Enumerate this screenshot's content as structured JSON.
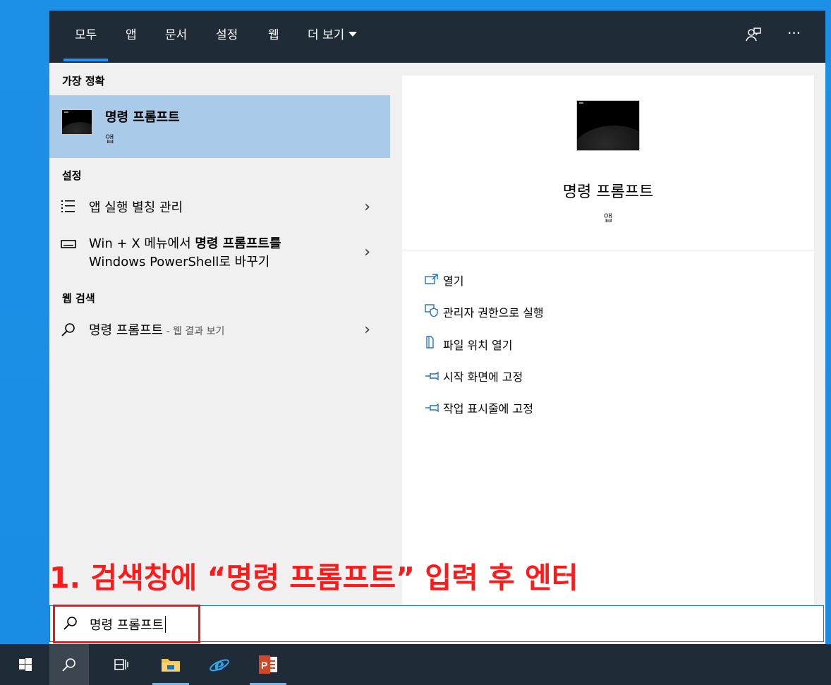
{
  "search": {
    "tabs": [
      {
        "label": "모두"
      },
      {
        "label": "앱"
      },
      {
        "label": "문서"
      },
      {
        "label": "설정"
      },
      {
        "label": "웹"
      },
      {
        "label": "더 보기"
      }
    ],
    "query": "명령 프롬프트"
  },
  "results": {
    "best_match_header": "가장 정확",
    "best_match": {
      "title": "명령 프롬프트",
      "type": "앱"
    },
    "settings_header": "설정",
    "settings_items": [
      {
        "label": "앱 실행 별칭 관리"
      },
      {
        "line1_pre": "Win + X 메뉴에서 ",
        "line1_bold": "명령 프롬프트",
        "line1_post": "를",
        "line2": "Windows PowerShell로 바꾸기"
      }
    ],
    "web_header": "웹 검색",
    "web_item": {
      "label": "명령 프롬프트",
      "suffix": " - 웹 결과 보기"
    }
  },
  "preview": {
    "title": "명령 프롬프트",
    "type": "앱",
    "actions": [
      {
        "label": "열기",
        "icon": "open-icon"
      },
      {
        "label": "관리자 권한으로 실행",
        "icon": "shield-icon"
      },
      {
        "label": "파일 위치 열기",
        "icon": "file-location-icon"
      },
      {
        "label": "시작 화면에 고정",
        "icon": "pin-icon"
      },
      {
        "label": "작업 표시줄에 고정",
        "icon": "pin-icon"
      }
    ]
  },
  "annotation": {
    "text": "1. 검색창에 “명령 프롬프트” 입력 후 엔터",
    "color": "#ff1a1a"
  },
  "colors": {
    "accent": "#1e90ff",
    "selection": "#a9cbe9",
    "taskbar": "#1f2b36"
  }
}
